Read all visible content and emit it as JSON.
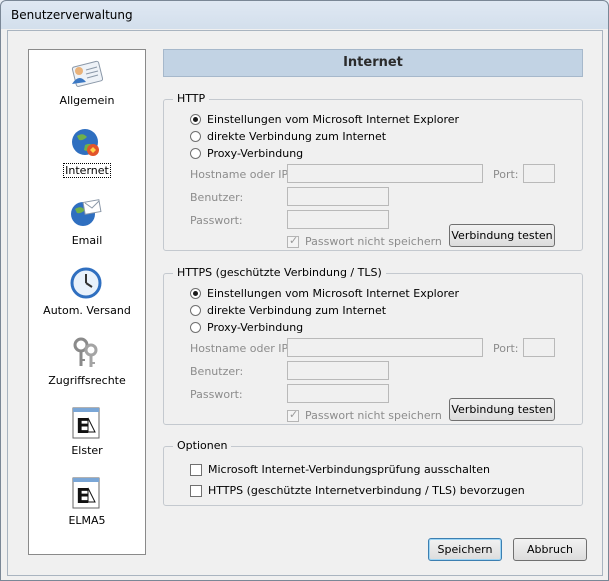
{
  "window": {
    "title": "Benutzerverwaltung"
  },
  "sidebar": {
    "items": [
      {
        "label": "Allgemein",
        "icon": "user-card-icon"
      },
      {
        "label": "Internet",
        "icon": "globe-icon",
        "active": true
      },
      {
        "label": "Email",
        "icon": "globe-mail-icon"
      },
      {
        "label": "Autom. Versand",
        "icon": "clock-icon"
      },
      {
        "label": "Zugriffsrechte",
        "icon": "keys-icon"
      },
      {
        "label": "Elster",
        "icon": "elster-doc-icon"
      },
      {
        "label": "ELMA5",
        "icon": "elma-doc-icon"
      }
    ]
  },
  "header": {
    "title": "Internet"
  },
  "http": {
    "legend": "HTTP",
    "options": [
      "Einstellungen vom Microsoft Internet Explorer",
      "direkte Verbindung zum Internet",
      "Proxy-Verbindung"
    ],
    "selected": 0,
    "host_label": "Hostname oder IP:",
    "port_label": "Port:",
    "user_label": "Benutzer:",
    "pass_label": "Passwort:",
    "no_save_label": "Passwort nicht speichern",
    "test_button": "Verbindung testen"
  },
  "https": {
    "legend": "HTTPS  (geschützte Verbindung / TLS)",
    "options": [
      "Einstellungen vom Microsoft Internet Explorer",
      "direkte Verbindung zum Internet",
      "Proxy-Verbindung"
    ],
    "selected": 0,
    "host_label": "Hostname oder IP:",
    "port_label": "Port:",
    "user_label": "Benutzer:",
    "pass_label": "Passwort:",
    "no_save_label": "Passwort nicht speichern",
    "test_button": "Verbindung testen"
  },
  "optionen": {
    "legend": "Optionen",
    "items": [
      "Microsoft Internet-Verbindungsprüfung ausschalten",
      "HTTPS (geschützte Internetverbindung / TLS) bevorzugen"
    ]
  },
  "footer": {
    "save": "Speichern",
    "cancel": "Abbruch"
  },
  "colors": {
    "header_bg": "#c2d3e4",
    "accent": "#3c7fb1"
  }
}
